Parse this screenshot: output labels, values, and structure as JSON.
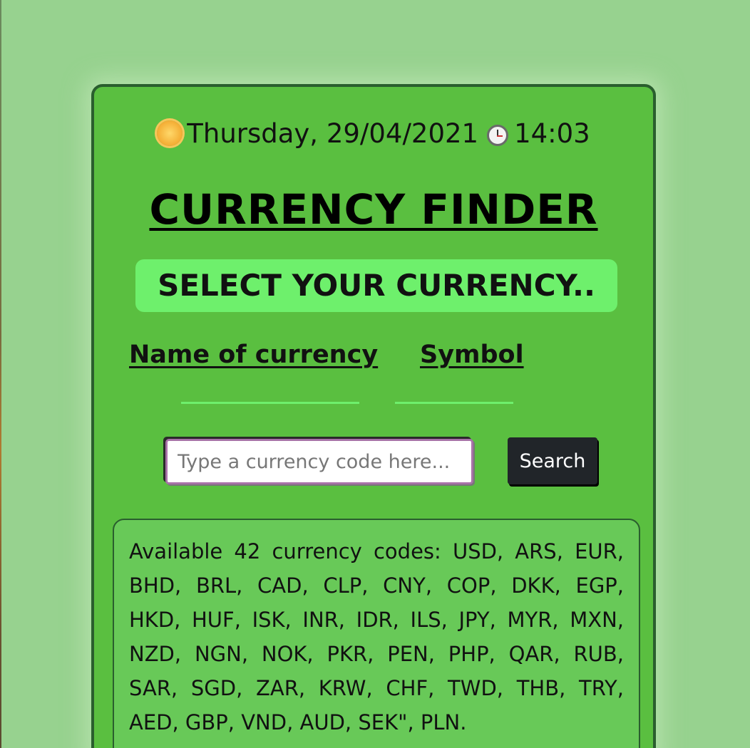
{
  "header": {
    "date_text": "Thursday, 29/04/2021",
    "time_text": "14:03",
    "icons": [
      "sun-icon",
      "stopwatch-icon"
    ]
  },
  "title": "CURRENCY FINDER",
  "banner": "SELECT YOUR CURRENCY..",
  "columns": {
    "name_label": "Name of currency",
    "symbol_label": "Symbol"
  },
  "search": {
    "value": "",
    "placeholder": "Type a currency code here...",
    "button_label": "Search"
  },
  "available_codes_text": "Available 42 currency codes: USD, ARS, EUR, BHD, BRL, CAD, CLP, CNY, COP, DKK, EGP, HKD, HUF, ISK, INR, IDR, ILS, JPY, MYR, MXN, NZD, NGN, NOK, PKR, PEN, PHP, QAR, RUB, SAR, SGD, ZAR, KRW, CHF, TWD, THB, TRY, AED, GBP, VND, AUD, SEK\", PLN.",
  "colors": {
    "page_background": "#97d28f",
    "card_background": "#5abf40",
    "card_border": "#2a5e2e",
    "accent_green": "#6ef06c",
    "button_background": "#212529",
    "input_border": "#a872a8"
  }
}
